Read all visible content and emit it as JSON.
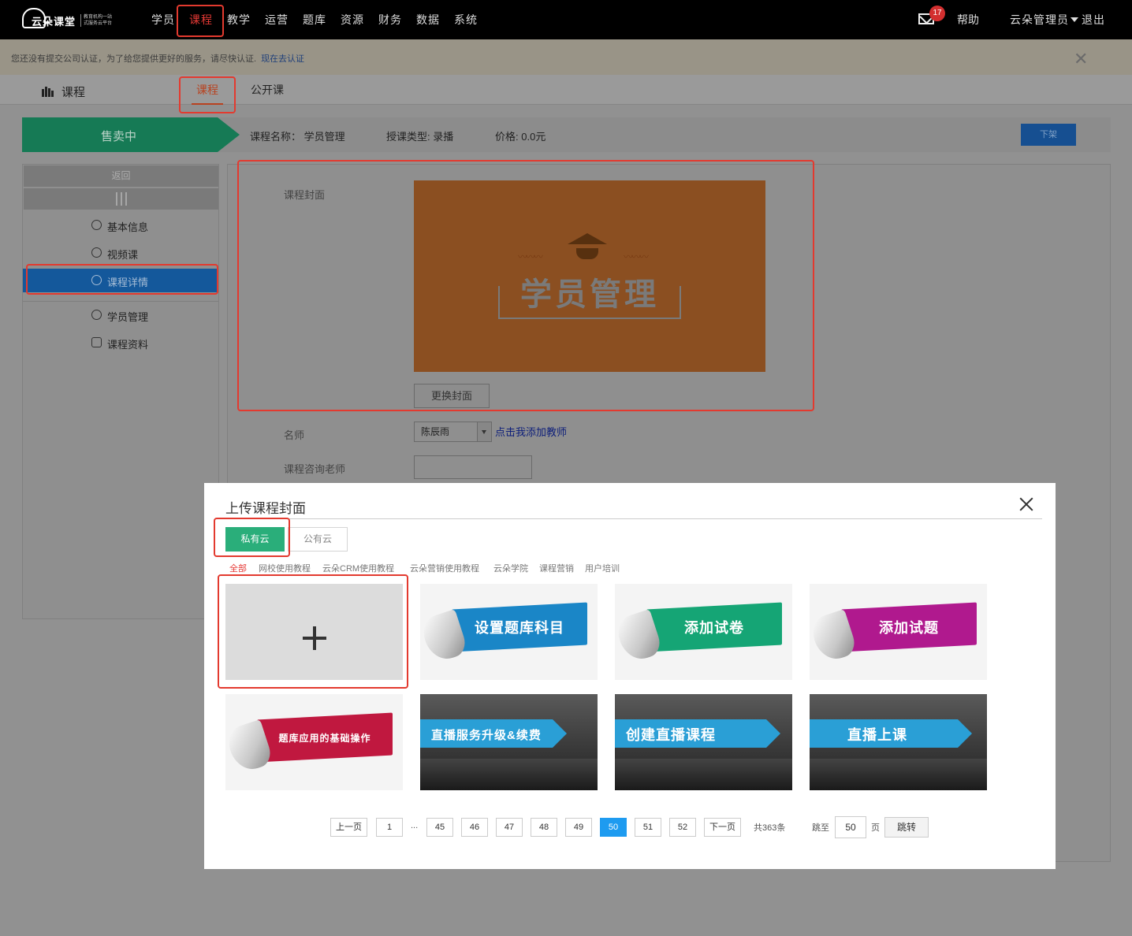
{
  "header": {
    "logo_text": "云朵课堂",
    "logo_sub": "教育机构一站式服务云平台",
    "nav": [
      "学员",
      "课程",
      "教学",
      "运营",
      "题库",
      "资源",
      "财务",
      "数据",
      "系统"
    ],
    "active_nav": "课程",
    "mail_count": "17",
    "help": "帮助",
    "user": "云朵管理员",
    "logout": "退出"
  },
  "notice": {
    "text": "您还没有提交公司认证，为了给您提供更好的服务，请尽快认证.",
    "link": "现在去认证",
    "close": "✕"
  },
  "subhead": {
    "title": "课程",
    "tab_course": "课程",
    "tab_public": "公开课"
  },
  "status": {
    "state": "售卖中",
    "name_label": "课程名称：",
    "name_value": "学员管理",
    "type_label": "授课类型:",
    "type_value": "录播",
    "price_label": "价格:",
    "price_value": "0.0元",
    "off_button": "下架"
  },
  "sidebar": {
    "back": "返回",
    "items": [
      {
        "label": "基本信息",
        "icon": "list-icon"
      },
      {
        "label": "视频课",
        "icon": "play-icon"
      },
      {
        "label": "课程详情",
        "icon": "detail-icon"
      },
      {
        "label": "学员管理",
        "icon": "users-icon"
      },
      {
        "label": "课程资料",
        "icon": "edit-icon"
      }
    ],
    "active": "课程详情"
  },
  "form": {
    "cover_label": "课程封面",
    "cover_title": "学员管理",
    "change_cover": "更换封面",
    "teacher_label": "名师",
    "teacher_value": "陈辰雨",
    "add_teacher": "点击我添加教师",
    "consult_label": "课程咨询老师"
  },
  "modal": {
    "title": "上传课程封面",
    "tab_private": "私有云",
    "tab_public": "公有云",
    "categories": [
      "全部",
      "网校使用教程",
      "云朵CRM使用教程",
      "云朵营销使用教程",
      "云朵学院",
      "课程营销",
      "用户培训"
    ],
    "active_category": "全部",
    "add_symbol": "+",
    "thumbnails": [
      {
        "text": "设置题库科目",
        "color": "#1a86c7"
      },
      {
        "text": "添加试卷",
        "color": "#15a575"
      },
      {
        "text": "添加试题",
        "color": "#b0198e"
      },
      {
        "text": "题库应用的基础操作",
        "color": "#c0183f"
      },
      {
        "text": "直播服务升级&续费"
      },
      {
        "text": "创建直播课程"
      },
      {
        "text": "直播上课"
      }
    ],
    "pagination": {
      "prev": "上一页",
      "first": "1",
      "ellipsis": "...",
      "pages": [
        "45",
        "46",
        "47",
        "48",
        "49",
        "50",
        "51",
        "52"
      ],
      "current": "50",
      "next": "下一页",
      "total": "共363条",
      "jump_label": "跳至",
      "jump_value": "50",
      "page_unit": "页",
      "go": "跳转"
    }
  }
}
